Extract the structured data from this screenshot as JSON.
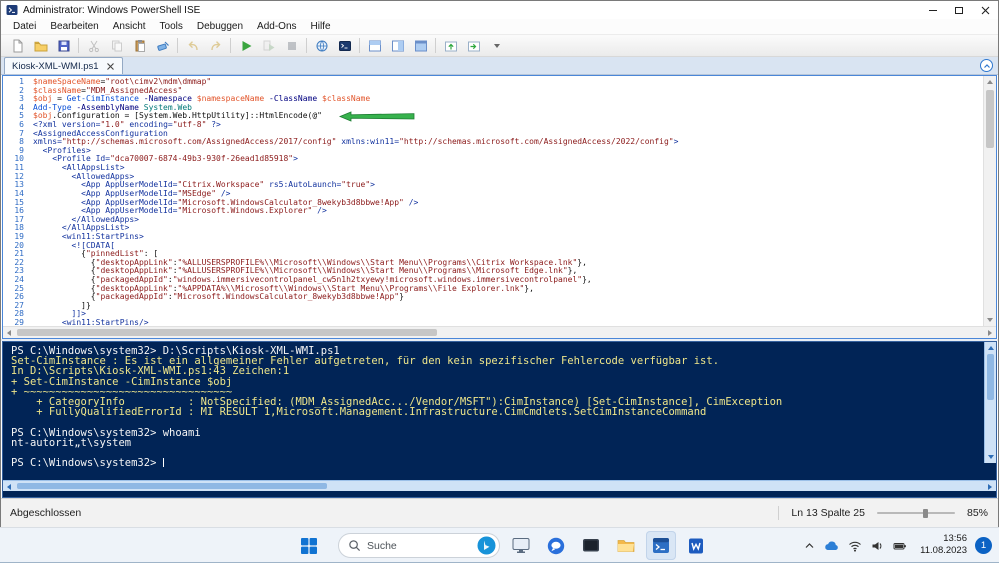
{
  "window": {
    "title": "Administrator: Windows PowerShell ISE"
  },
  "menubar": {
    "items": [
      "Datei",
      "Bearbeiten",
      "Ansicht",
      "Tools",
      "Debuggen",
      "Add-Ons",
      "Hilfe"
    ]
  },
  "toolbar": {
    "buttons": [
      "new-script",
      "open-script",
      "save",
      "cut",
      "copy",
      "paste",
      "clear-console-pane",
      "undo",
      "redo",
      "run-script",
      "run-selection",
      "stop-operation",
      "new-remote-powershell-tab",
      "start-powershell-exe",
      "show-script-pane-top",
      "show-script-pane-right",
      "show-script-pane-maximized",
      "show-command-addon",
      "show-command-window",
      "toolbar-overflow"
    ]
  },
  "tab": {
    "label": "Kiosk-XML-WMI.ps1"
  },
  "editor": {
    "lines": [
      {
        "n": 1,
        "seg": [
          [
            "v",
            "$nameSpaceName"
          ],
          [
            "k",
            "="
          ],
          [
            "s",
            "\"root\\cimv2\\mdm\\dmmap\""
          ]
        ]
      },
      {
        "n": 2,
        "seg": [
          [
            "v",
            "$className"
          ],
          [
            "k",
            "="
          ],
          [
            "s",
            "\"MDM_AssignedAccess\""
          ]
        ]
      },
      {
        "n": 3,
        "seg": [
          [
            "v",
            "$obj"
          ],
          [
            "k",
            " = "
          ],
          [
            "c",
            "Get-CimInstance"
          ],
          [
            "p",
            " -Namespace "
          ],
          [
            "v",
            "$namespaceName"
          ],
          [
            "p",
            " -ClassName "
          ],
          [
            "v",
            "$className"
          ]
        ]
      },
      {
        "n": 4,
        "seg": [
          [
            "c",
            "Add-Type"
          ],
          [
            "p",
            " -AssemblyName "
          ],
          [
            "t",
            "System.Web"
          ]
        ]
      },
      {
        "n": 5,
        "seg": [
          [
            "v",
            "$obj"
          ],
          [
            "k",
            ".Configuration = [System.Web.HttpUtility]::HtmlEncode(@\""
          ]
        ]
      },
      {
        "n": 6,
        "seg": [
          [
            "x",
            "<?xml version="
          ],
          [
            "s",
            "\"1.0\""
          ],
          [
            "x",
            " encoding="
          ],
          [
            "s",
            "\"utf-8\""
          ],
          [
            "x",
            " ?>"
          ]
        ]
      },
      {
        "n": 7,
        "seg": [
          [
            "x",
            "<AssignedAccessConfiguration"
          ]
        ]
      },
      {
        "n": 8,
        "seg": [
          [
            "x",
            "xmlns="
          ],
          [
            "s",
            "\"http://schemas.microsoft.com/AssignedAccess/2017/config\""
          ],
          [
            "x",
            " xmlns:win11="
          ],
          [
            "s",
            "\"http://schemas.microsoft.com/AssignedAccess/2022/config\""
          ],
          [
            "x",
            ">"
          ]
        ]
      },
      {
        "n": 9,
        "seg": [
          [
            "x",
            "  <Profiles>"
          ]
        ]
      },
      {
        "n": 10,
        "seg": [
          [
            "x",
            "    <Profile Id="
          ],
          [
            "s",
            "\"dca70007-6874-49b3-930f-26ead1d85918\""
          ],
          [
            "x",
            ">"
          ]
        ]
      },
      {
        "n": 11,
        "seg": [
          [
            "x",
            "      <AllAppsList>"
          ]
        ]
      },
      {
        "n": 12,
        "seg": [
          [
            "x",
            "        <AllowedApps>"
          ]
        ]
      },
      {
        "n": 13,
        "seg": [
          [
            "x",
            "          <App AppUserModelId="
          ],
          [
            "s",
            "\"Citrix.Workspace\""
          ],
          [
            "x",
            " rs5:AutoLaunch="
          ],
          [
            "s",
            "\"true\""
          ],
          [
            "x",
            ">"
          ]
        ]
      },
      {
        "n": 14,
        "seg": [
          [
            "x",
            "          <App AppUserModelId="
          ],
          [
            "s",
            "\"MSEdge\""
          ],
          [
            "x",
            " />"
          ]
        ]
      },
      {
        "n": 15,
        "seg": [
          [
            "x",
            "          <App AppUserModelId="
          ],
          [
            "s",
            "\"Microsoft.WindowsCalculator_8wekyb3d8bbwe!App\""
          ],
          [
            "x",
            " />"
          ]
        ]
      },
      {
        "n": 16,
        "seg": [
          [
            "x",
            "          <App AppUserModelId="
          ],
          [
            "s",
            "\"Microsoft.Windows.Explorer\""
          ],
          [
            "x",
            " />"
          ]
        ]
      },
      {
        "n": 17,
        "seg": [
          [
            "x",
            "        </AllowedApps>"
          ]
        ]
      },
      {
        "n": 18,
        "seg": [
          [
            "x",
            "      </AllAppsList>"
          ]
        ]
      },
      {
        "n": 19,
        "seg": [
          [
            "x",
            "      <win11:StartPins>"
          ]
        ]
      },
      {
        "n": 20,
        "seg": [
          [
            "x",
            "        <![CDATA["
          ]
        ]
      },
      {
        "n": 21,
        "seg": [
          [
            "k",
            "          {"
          ],
          [
            "s",
            "\"pinnedList\""
          ],
          [
            "k",
            ": ["
          ]
        ]
      },
      {
        "n": 22,
        "seg": [
          [
            "k",
            "            {"
          ],
          [
            "s",
            "\"desktopAppLink\""
          ],
          [
            "k",
            ":"
          ],
          [
            "s",
            "\"%ALLUSERSPROFILE%\\\\Microsoft\\\\Windows\\\\Start Menu\\\\Programs\\\\Citrix Workspace.lnk\""
          ],
          [
            "k",
            "},"
          ]
        ]
      },
      {
        "n": 23,
        "seg": [
          [
            "k",
            "            {"
          ],
          [
            "s",
            "\"desktopAppLink\""
          ],
          [
            "k",
            ":"
          ],
          [
            "s",
            "\"%ALLUSERSPROFILE%\\\\Microsoft\\\\Windows\\\\Start Menu\\\\Programs\\\\Microsoft Edge.lnk\""
          ],
          [
            "k",
            "},"
          ]
        ]
      },
      {
        "n": 24,
        "seg": [
          [
            "k",
            "            {"
          ],
          [
            "s",
            "\"packagedAppId\""
          ],
          [
            "k",
            ":"
          ],
          [
            "s",
            "\"windows.immersivecontrolpanel_cw5n1h2txyewy!microsoft.windows.immersivecontrolpanel\""
          ],
          [
            "k",
            "},"
          ]
        ]
      },
      {
        "n": 25,
        "seg": [
          [
            "k",
            "            {"
          ],
          [
            "s",
            "\"desktopAppLink\""
          ],
          [
            "k",
            ":"
          ],
          [
            "s",
            "\"%APPDATA%\\\\Microsoft\\\\Windows\\\\Start Menu\\\\Programs\\\\File Explorer.lnk\""
          ],
          [
            "k",
            "},"
          ]
        ]
      },
      {
        "n": 26,
        "seg": [
          [
            "k",
            "            {"
          ],
          [
            "s",
            "\"packagedAppId\""
          ],
          [
            "k",
            ":"
          ],
          [
            "s",
            "\"Microsoft.WindowsCalculator_8wekyb3d8bbwe!App\""
          ],
          [
            "k",
            "}"
          ]
        ]
      },
      {
        "n": 27,
        "seg": [
          [
            "k",
            "          ]}"
          ]
        ]
      },
      {
        "n": 28,
        "seg": [
          [
            "x",
            "        ]]>"
          ]
        ]
      },
      {
        "n": 29,
        "seg": [
          [
            "x",
            "      <win11:StartPins/>"
          ]
        ]
      }
    ]
  },
  "console": {
    "lines": [
      {
        "t": "input",
        "text": "PS C:\\Windows\\system32> D:\\Scripts\\Kiosk-XML-WMI.ps1"
      },
      {
        "t": "error",
        "text": "Set-CimInstance : Es ist ein allgemeiner Fehler aufgetreten, für den kein spezifischer Fehlercode verfügbar ist."
      },
      {
        "t": "error",
        "text": "In D:\\Scripts\\Kiosk-XML-WMI.ps1:43 Zeichen:1"
      },
      {
        "t": "error",
        "text": "+ Set-CimInstance -CimInstance $obj"
      },
      {
        "t": "error",
        "text": "+ ~~~~~~~~~~~~~~~~~~~~~~~~~~~~~~~~~"
      },
      {
        "t": "error",
        "text": "    + CategoryInfo          : NotSpecified: (MDM_AssignedAcc.../Vendor/MSFT\"):CimInstance) [Set-CimInstance], CimException"
      },
      {
        "t": "error",
        "text": "    + FullyQualifiedErrorId : MI RESULT 1,Microsoft.Management.Infrastructure.CimCmdlets.SetCimInstanceCommand"
      },
      {
        "t": "blank",
        "text": ""
      },
      {
        "t": "input",
        "text": "PS C:\\Windows\\system32> whoami"
      },
      {
        "t": "output",
        "text": "nt-autorit„t\\system"
      },
      {
        "t": "blank",
        "text": ""
      },
      {
        "t": "input",
        "text": "PS C:\\Windows\\system32> ",
        "cursor": true
      }
    ]
  },
  "statusbar": {
    "status": "Abgeschlossen",
    "line_col": "Ln 13 Spalte 25",
    "zoom": "85%"
  },
  "taskbar": {
    "search_placeholder": "Suche",
    "clock": {
      "time": "13:56",
      "date": "11.08.2023"
    },
    "badge_count": "1"
  },
  "colors": {
    "console_bg": "#012456",
    "error_text": "#efe68a",
    "accent_blue": "#2767b0",
    "run_green": "#3aa53f",
    "annotation_green": "#37b24d"
  }
}
